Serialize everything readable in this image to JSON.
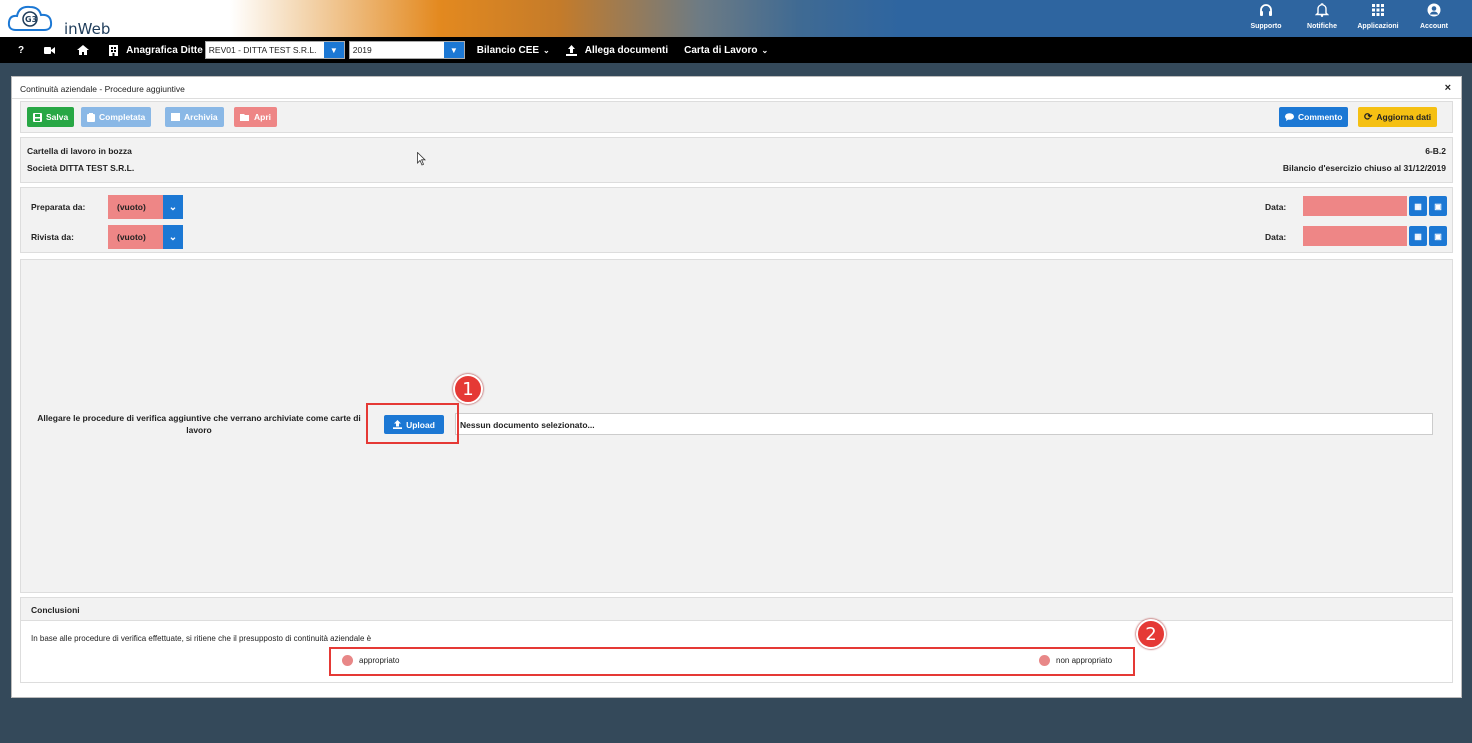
{
  "brand": {
    "logo_text": "inWeb",
    "logo_mark": "G3"
  },
  "top_icons": [
    {
      "label": "Supporto",
      "icon": "headset-icon",
      "glyph": "🎧"
    },
    {
      "label": "Notifiche",
      "icon": "bell-icon",
      "glyph": "🔔"
    },
    {
      "label": "Applicazioni",
      "icon": "grid-icon",
      "glyph": "▦"
    },
    {
      "label": "Account",
      "icon": "user-icon",
      "glyph": "●"
    }
  ],
  "nav": {
    "help": "?",
    "anagrafica": "Anagrafica Ditte",
    "company_select": "REV01 - DITTA TEST S.R.L.",
    "year_select": "2019",
    "bilancio": "Bilancio CEE",
    "allega": "Allega documenti",
    "carta": "Carta di Lavoro"
  },
  "panel": {
    "title": "Continuità aziendale - Procedure aggiuntive",
    "close": "×"
  },
  "toolbar": {
    "salva": "Salva",
    "completata": "Completata",
    "archivia": "Archivia",
    "apri": "Apri",
    "commento": "Commento",
    "aggiorna": "Aggiorna dati",
    "colors": {
      "salva": "#28a745",
      "completata": "#8ab8e6",
      "archivia": "#8ab8e6",
      "apri": "#ee8686",
      "commento": "#1c78d4",
      "aggiorna": "#f5c013"
    }
  },
  "info": {
    "status": "Cartella di lavoro in bozza",
    "company": "Società DITTA TEST S.R.L.",
    "code": "6-B.2",
    "period": "Bilancio d'esercizio chiuso al 31/12/2019"
  },
  "prep": {
    "preparata_label": "Preparata da:",
    "preparata_value": "(vuoto)",
    "rivista_label": "Rivista da:",
    "rivista_value": "(vuoto)",
    "data_label": "Data:"
  },
  "upload": {
    "label": "Allegare le procedure di verifica aggiuntive che verrano archiviate come carte di lavoro",
    "button": "Upload",
    "file_status": "Nessun documento selezionato..."
  },
  "conclusioni": {
    "heading": "Conclusioni",
    "text": "In base alle procedure di verifica effettuate, si ritiene che il presupposto di continuità aziendale è",
    "opt1": "appropriato",
    "opt2": "non appropriato"
  },
  "annotations": {
    "badge1": "1",
    "badge2": "2"
  }
}
